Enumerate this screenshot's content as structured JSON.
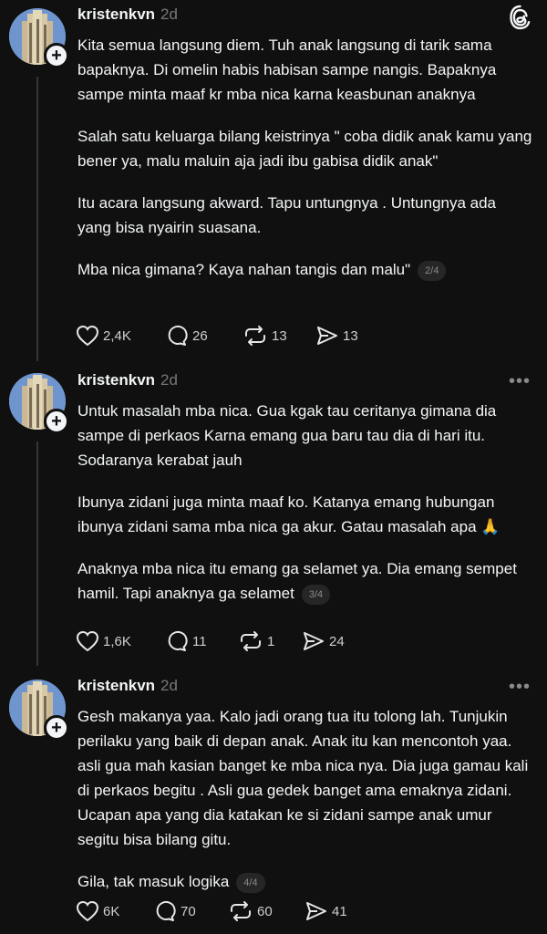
{
  "posts": [
    {
      "username": "kristenkvn",
      "time": "2d",
      "paragraphs": [
        "Kita semua langsung diem. Tuh anak langsung di tarik sama bapaknya. Di omelin habis habisan sampe nangis. Bapaknya sampe minta maaf kr mba nica karna keasbunan anaknya",
        "Salah satu keluarga bilang keistrinya \" coba didik anak kamu yang bener ya, malu maluin aja jadi ibu gabisa didik anak\"",
        "Itu acara langsung akward. Tapu untungnya . Untungnya ada yang bisa nyairin suasana.",
        "Mba nica gimana? Kaya nahan tangis dan malu\""
      ],
      "page": "2/4",
      "likes": "2,4K",
      "replies": "26",
      "reposts": "13",
      "shares": "13"
    },
    {
      "username": "kristenkvn",
      "time": "2d",
      "paragraphs": [
        "Untuk masalah mba nica. Gua kgak tau ceritanya gimana dia sampe di perkaos Karna emang gua baru tau dia di hari itu. Sodaranya kerabat jauh",
        "Ibunya zidani juga minta maaf ko. Katanya emang hubungan ibunya zidani sama mba nica ga akur. Gatau masalah apa 🙏",
        "Anaknya mba nica itu emang ga selamet ya. Dia emang sempet hamil. Tapi anaknya ga selamet"
      ],
      "page": "3/4",
      "likes": "1,6K",
      "replies": "11",
      "reposts": "1",
      "shares": "24"
    },
    {
      "username": "kristenkvn",
      "time": "2d",
      "paragraphs": [
        "Gesh makanya yaa. Kalo jadi orang tua itu tolong lah. Tunjukin perilaku yang baik di depan anak. Anak itu kan mencontoh yaa. asli gua mah kasian banget ke mba nica nya. Dia juga gamau kali di perkaos begitu . Asli gua gedek banget ama emaknya zidani. Ucapan apa yang dia katakan ke si zidani sampe anak umur segitu bisa bilang gitu.",
        "Gila, tak masuk logika"
      ],
      "page": "4/4",
      "likes": "6K",
      "replies": "70",
      "reposts": "60",
      "shares": "41"
    }
  ],
  "more_icon": "•••",
  "colors": {
    "background": "#101010",
    "text": "#f3f5f7",
    "muted": "#777777",
    "badge": "#262626"
  },
  "icons": [
    "threads-logo-icon",
    "follow-plus-icon",
    "heart-icon",
    "reply-icon",
    "repost-icon",
    "share-icon",
    "more-icon"
  ]
}
